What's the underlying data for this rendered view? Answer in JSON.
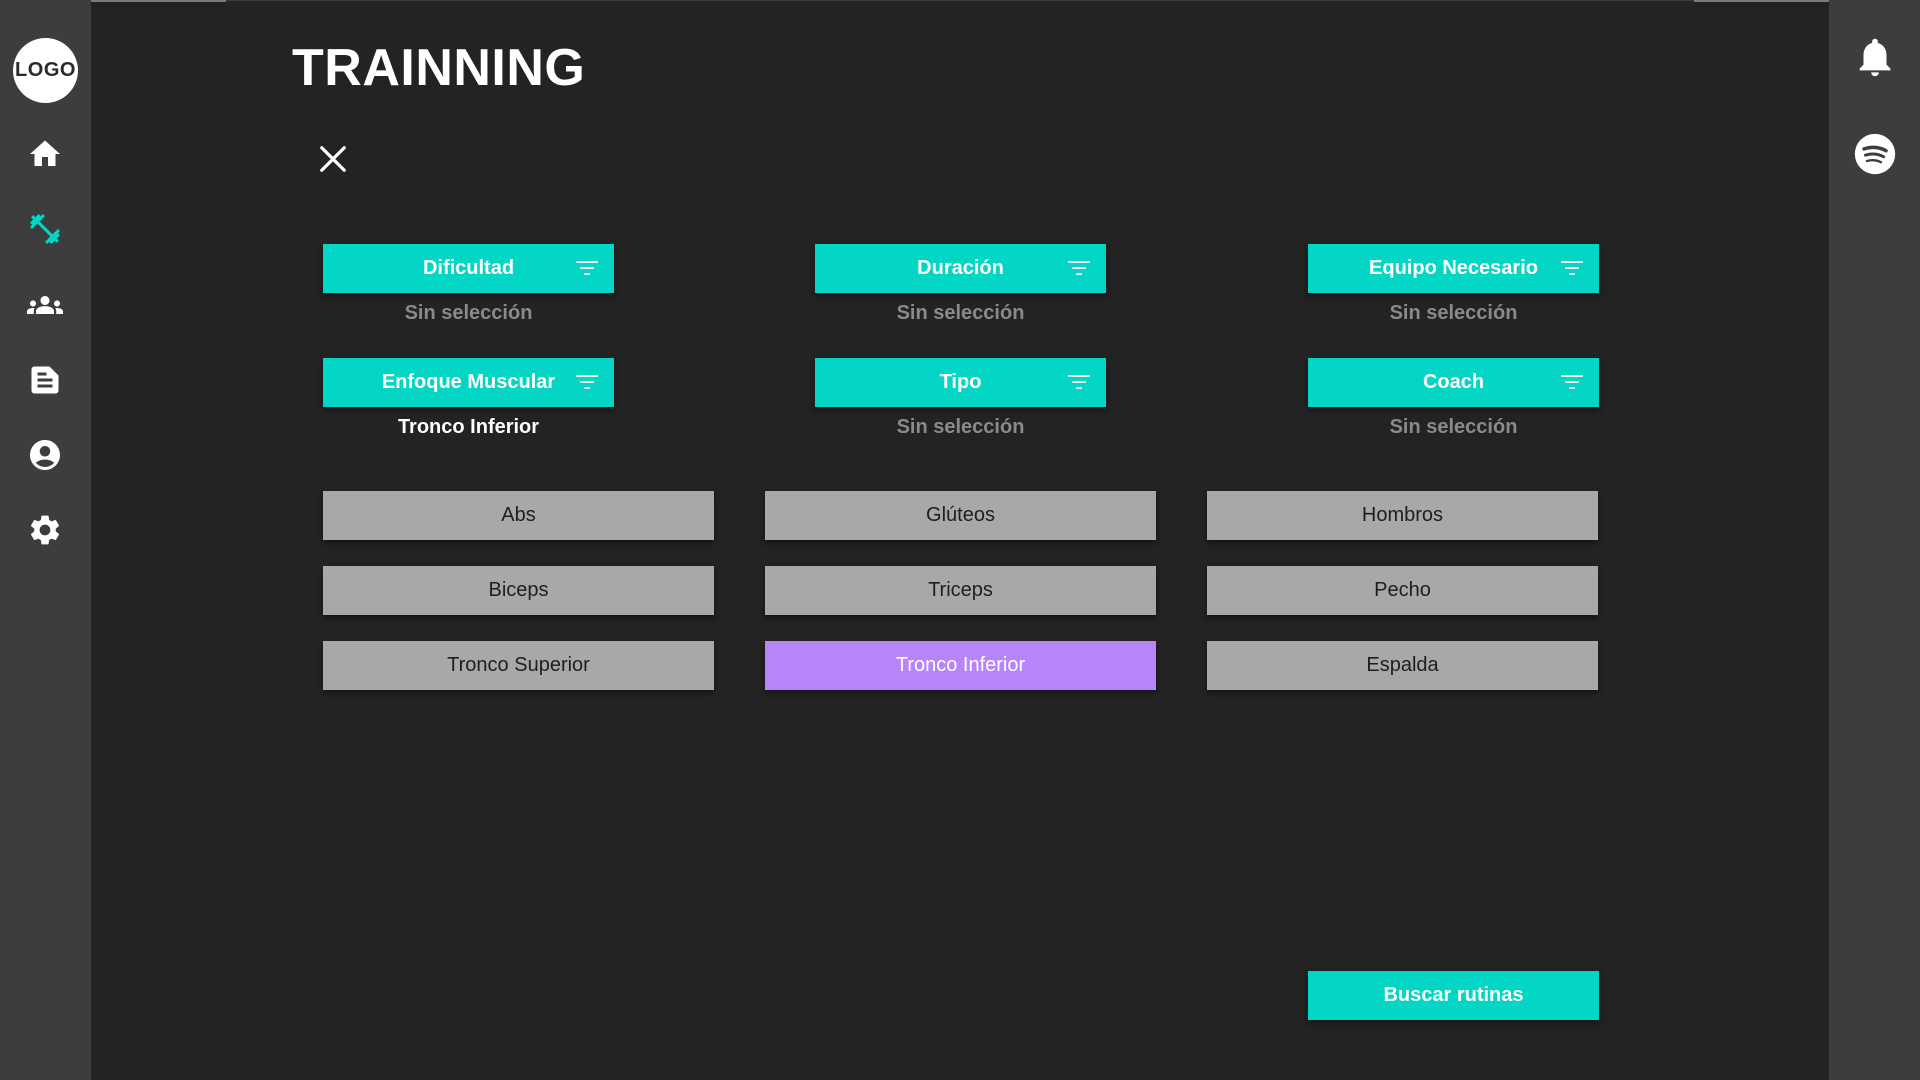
{
  "app": {
    "logo_text": "LOGO",
    "accent_color": "#04d6c5",
    "selected_color": "#b784f9"
  },
  "sidebar": {
    "items": [
      {
        "id": "home",
        "icon": "home-icon",
        "active": false
      },
      {
        "id": "training",
        "icon": "dumbbell-icon",
        "active": true
      },
      {
        "id": "community",
        "icon": "group-icon",
        "active": false
      },
      {
        "id": "notes",
        "icon": "document-icon",
        "active": false
      },
      {
        "id": "profile",
        "icon": "user-circle-icon",
        "active": false
      },
      {
        "id": "settings",
        "icon": "gear-icon",
        "active": false
      }
    ]
  },
  "right_bar": {
    "items": [
      {
        "id": "notifications",
        "icon": "bell-icon"
      },
      {
        "id": "spotify",
        "icon": "spotify-icon"
      }
    ]
  },
  "page": {
    "title": "TRAINNING"
  },
  "filters": [
    {
      "label": "Dificultad",
      "value": "Sin selección",
      "active": false
    },
    {
      "label": "Duración",
      "value": "Sin selección",
      "active": false
    },
    {
      "label": "Equipo Necesario",
      "value": "Sin selección",
      "active": false
    },
    {
      "label": "Enfoque Muscular",
      "value": "Tronco Inferior",
      "active": true
    },
    {
      "label": "Tipo",
      "value": "Sin selección",
      "active": false
    },
    {
      "label": "Coach",
      "value": "Sin selección",
      "active": false
    }
  ],
  "options": [
    {
      "label": "Abs",
      "selected": false
    },
    {
      "label": "Glúteos",
      "selected": false
    },
    {
      "label": "Hombros",
      "selected": false
    },
    {
      "label": "Biceps",
      "selected": false
    },
    {
      "label": "Triceps",
      "selected": false
    },
    {
      "label": "Pecho",
      "selected": false
    },
    {
      "label": "Tronco Superior",
      "selected": false
    },
    {
      "label": "Tronco Inferior",
      "selected": true
    },
    {
      "label": "Espalda",
      "selected": false
    }
  ],
  "actions": {
    "search_label": "Buscar rutinas"
  }
}
